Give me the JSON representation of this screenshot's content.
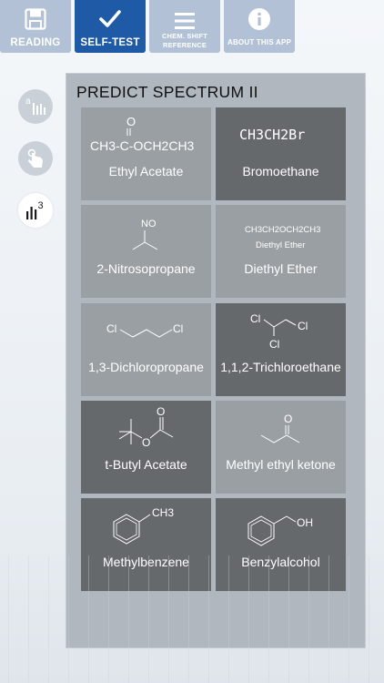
{
  "tabs": [
    {
      "label": "READING",
      "icon": "save-icon",
      "active": false
    },
    {
      "label": "SELF-TEST",
      "icon": "checkmark-icon",
      "active": true
    },
    {
      "label_line1": "CHEM. SHIFT",
      "label_line2": "REFERENCE",
      "icon": "menu-icon",
      "active": false
    },
    {
      "label": "ABOUT THIS APP",
      "icon": "info-icon",
      "active": false
    }
  ],
  "side_buttons": [
    {
      "icon": "spectrum-a-icon",
      "glyph": "a",
      "active": false
    },
    {
      "icon": "tap-hand-icon",
      "active": false
    },
    {
      "icon": "spectrum-3-icon",
      "glyph": "3",
      "active": true
    }
  ],
  "panel": {
    "title": "PREDICT SPECTRUM II"
  },
  "compounds": [
    {
      "name": "Ethyl Acetate",
      "formula_o": "O",
      "formula_text": "CH3-C-OCH2CH3"
    },
    {
      "name": "Bromoethane",
      "formula_text": "CH3CH2Br"
    },
    {
      "name": "2-Nitrosopropane",
      "label_no": "NO"
    },
    {
      "name": "Diethyl Ether",
      "formula_text": "CH3CH2OCH2CH3",
      "subtitle": "Diethyl Ether"
    },
    {
      "name": "1,3-Dichloropropane",
      "cl_left": "Cl",
      "cl_right": "Cl"
    },
    {
      "name": "1,1,2-Trichloroethane",
      "cl_top": "Cl",
      "cl_right": "Cl",
      "cl_bottom": "Cl"
    },
    {
      "name": "t-Butyl Acetate",
      "o_top": "O",
      "o_ester": "O"
    },
    {
      "name": "Methyl ethyl ketone",
      "o_top": "O"
    },
    {
      "name": "Methylbenzene",
      "label_ch3": "CH3"
    },
    {
      "name": "Benzylalcohol",
      "label_oh": "OH"
    }
  ],
  "colors": {
    "tab_active": "#1f5aa6",
    "tab_inactive": "#b3c1d6",
    "card_light": "#9a9fa4",
    "card_dark": "#65696c",
    "panel_bg": "#b1b7be"
  }
}
